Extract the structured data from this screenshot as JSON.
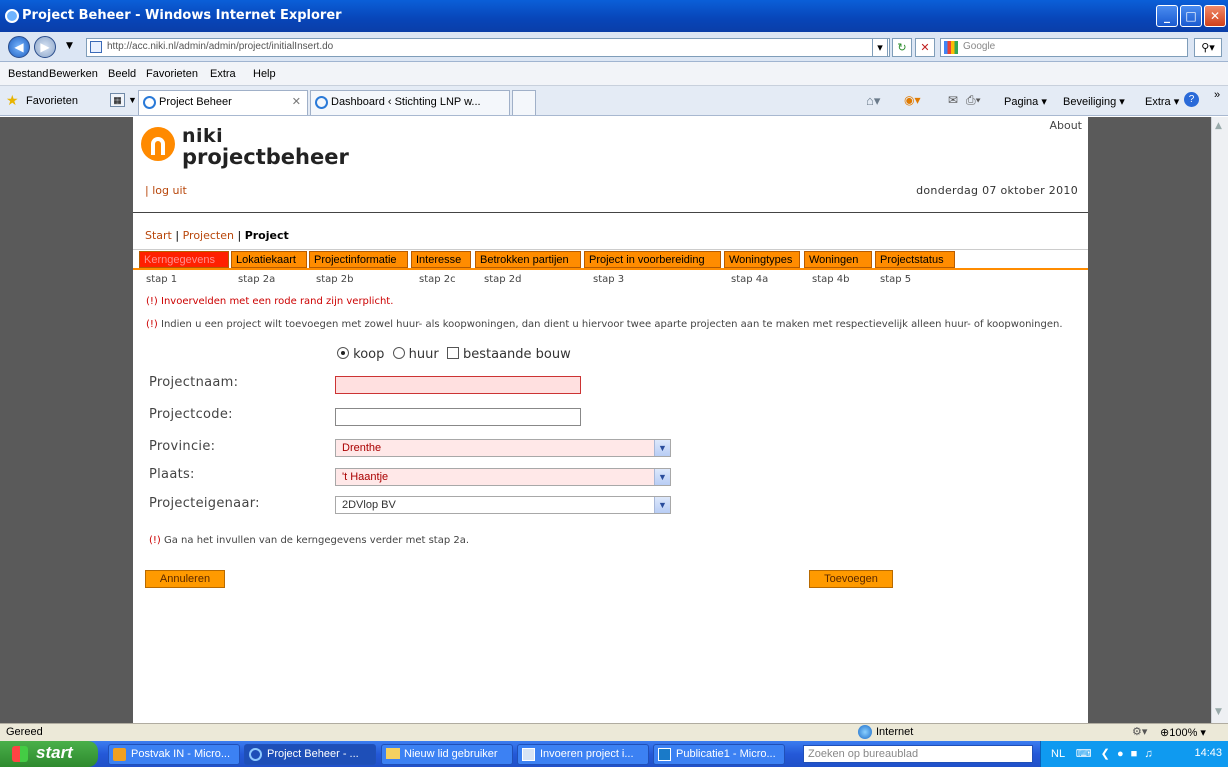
{
  "window": {
    "title": "Project Beheer - Windows Internet Explorer"
  },
  "address": {
    "url": "http://acc.niki.nl/admin/admin/project/initialInsert.do",
    "search_placeholder": "Google"
  },
  "menu": [
    "Bestand",
    "Bewerken",
    "Beeld",
    "Favorieten",
    "Extra",
    "Help"
  ],
  "favorites": {
    "label": "Favorieten"
  },
  "tabs": [
    {
      "label": "Project Beheer",
      "active": true
    },
    {
      "label": "Dashboard ‹ Stichting LNP w...",
      "active": false
    }
  ],
  "commandbar": {
    "pagina": "Pagina",
    "beveiliging": "Beveiliging",
    "extra": "Extra"
  },
  "page": {
    "about": "About",
    "logo_line1": "niki",
    "logo_line2": "projectbeheer",
    "logout": "| log uit",
    "date": "donderdag 07 oktober 2010",
    "breadcrumb": {
      "start": "Start",
      "sep": "|",
      "projecten": "Projecten",
      "project": "Project"
    },
    "steps": [
      {
        "tab": "Kerngegevens",
        "stap": "stap 1"
      },
      {
        "tab": "Lokatiekaart",
        "stap": "stap 2a"
      },
      {
        "tab": "Projectinformatie",
        "stap": "stap 2b"
      },
      {
        "tab": "Interesse",
        "stap": "stap 2c"
      },
      {
        "tab": "Betrokken partijen",
        "stap": "stap 2d"
      },
      {
        "tab": "Project in voorbereiding",
        "stap": "stap 3"
      },
      {
        "tab": "Woningtypes",
        "stap": "stap 4a"
      },
      {
        "tab": "Woningen",
        "stap": "stap 4b"
      },
      {
        "tab": "Projectstatus",
        "stap": "stap 5"
      }
    ],
    "notice_mark": "(!)",
    "notice_required": " Invoervelden met een rode rand zijn verplicht.",
    "notice_split": " Indien u een project wilt toevoegen met zowel huur- als koopwoningen, dan dient u hiervoor twee aparte projecten aan te maken met respectievelijk alleen huur- of koopwoningen.",
    "radio_koop": "koop",
    "radio_huur": "huur",
    "checkbox_bestaande": "bestaande bouw",
    "fields": {
      "projectnaam_label": "Projectnaam:",
      "projectnaam_value": "",
      "projectcode_label": "Projectcode:",
      "projectcode_value": "",
      "provincie_label": "Provincie:",
      "provincie_value": "Drenthe",
      "plaats_label": "Plaats:",
      "plaats_value": "'t Haantje",
      "eigenaar_label": "Projecteigenaar:",
      "eigenaar_value": "2DVlop BV"
    },
    "notice_next": " Ga na het invullen van de kerngegevens verder met stap 2a.",
    "btn_cancel": "Annuleren",
    "btn_add": "Toevoegen"
  },
  "status": {
    "left": "Gereed",
    "zone": "Internet",
    "zoom": "100%"
  },
  "taskbar": {
    "start": "start",
    "items": [
      "Postvak IN - Micro...",
      "Project Beheer - ...",
      "Nieuw lid gebruiker",
      "Invoeren project i...",
      "Publicatie1 - Micro..."
    ],
    "search": "Zoeken op bureaublad",
    "lang": "NL",
    "clock": "14:43"
  }
}
